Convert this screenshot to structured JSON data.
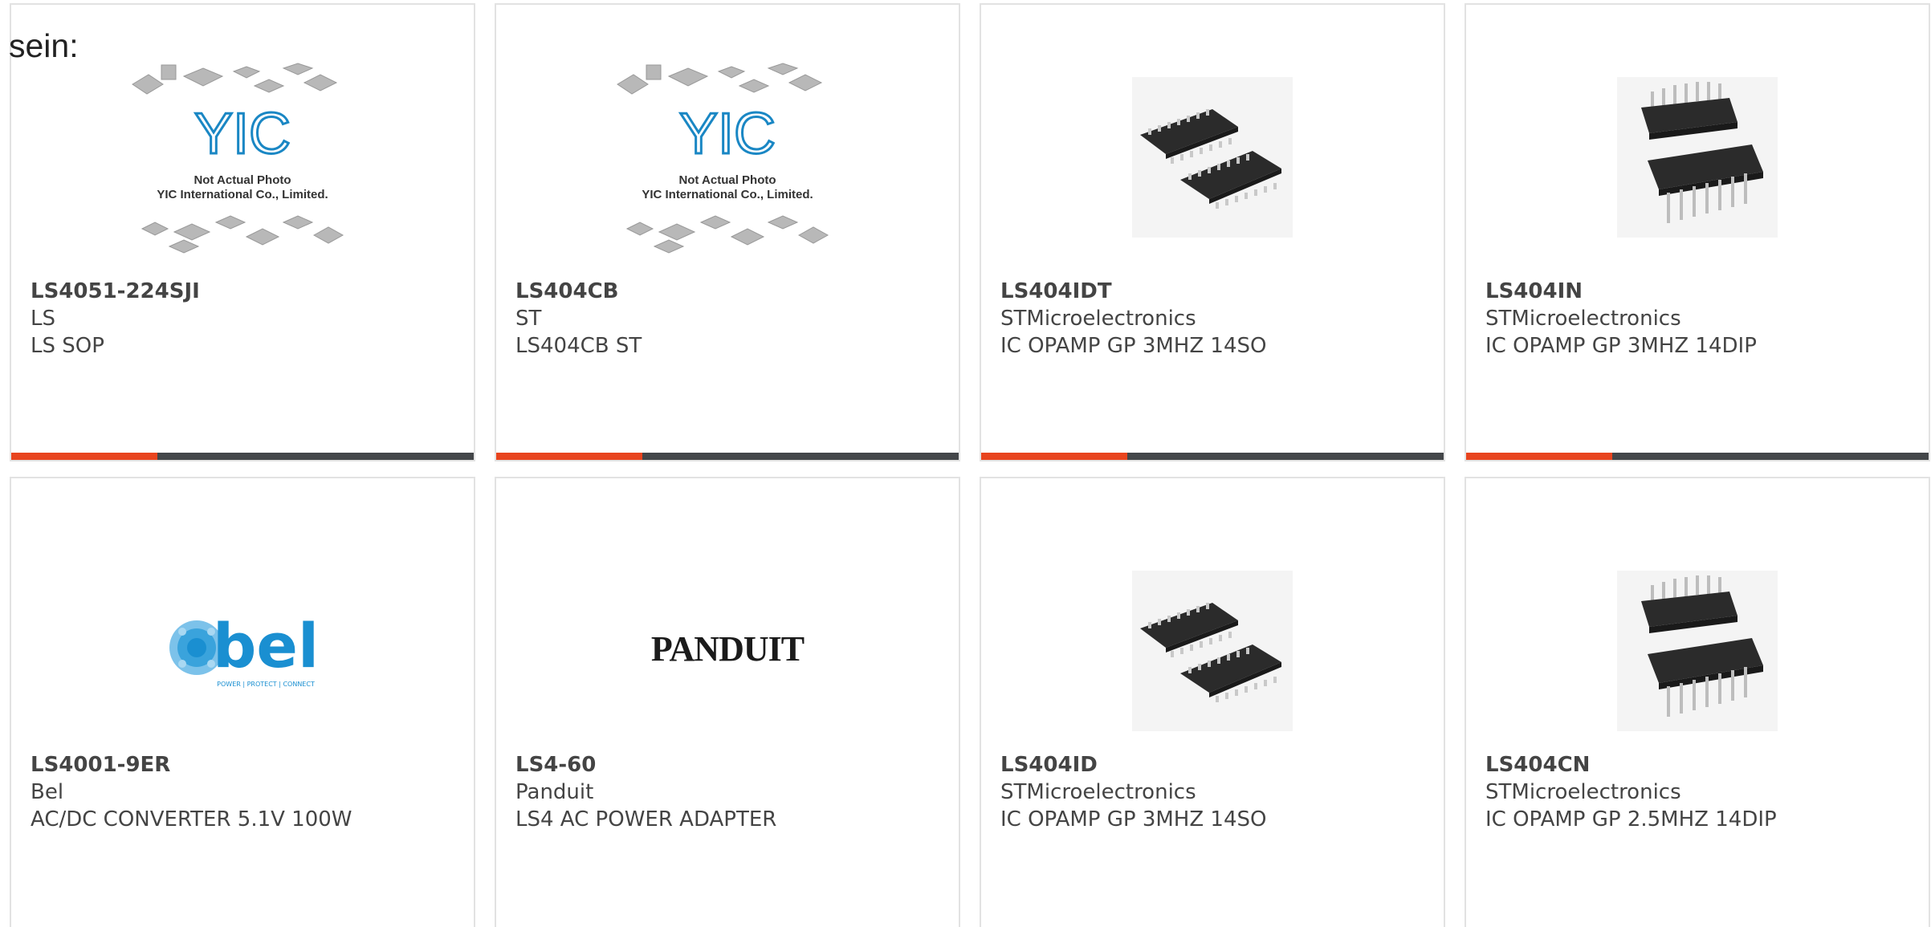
{
  "prefix_text": "sein:",
  "placeholder_image": {
    "line1": "Not Actual Photo",
    "line2": "YIC International Co., Limited.",
    "logo_text": "YIC"
  },
  "products": [
    {
      "part": "LS4051-224SJI",
      "maker": "LS",
      "desc": "LS SOP",
      "image": "placeholder"
    },
    {
      "part": "LS404CB",
      "maker": "ST",
      "desc": "LS404CB ST",
      "image": "placeholder"
    },
    {
      "part": "LS404IDT",
      "maker": "STMicroelectronics",
      "desc": "IC OPAMP GP 3MHZ 14SO",
      "image": "soic-chips"
    },
    {
      "part": "LS404IN",
      "maker": "STMicroelectronics",
      "desc": "IC OPAMP GP 3MHZ 14DIP",
      "image": "dip-chips"
    },
    {
      "part": "LS4001-9ER",
      "maker": "Bel",
      "desc": "AC/DC CONVERTER 5.1V 100W",
      "image": "bel-logo"
    },
    {
      "part": "LS4-60",
      "maker": "Panduit",
      "desc": "LS4 AC POWER ADAPTER",
      "image": "panduit-logo"
    },
    {
      "part": "LS404ID",
      "maker": "STMicroelectronics",
      "desc": "IC OPAMP GP 3MHZ 14SO",
      "image": "soic-chips"
    },
    {
      "part": "LS404CN",
      "maker": "STMicroelectronics",
      "desc": "IC OPAMP GP 2.5MHZ 14DIP",
      "image": "dip-chips"
    }
  ],
  "logos": {
    "bel": "bel",
    "bel_tagline": "POWER | PROTECT | CONNECT",
    "panduit": "PANDUIT"
  },
  "colors": {
    "accent": "#e8441e",
    "bar_dark": "#434649",
    "card_border": "#e2e2e2",
    "text": "#444444",
    "yic_blue": "#1a87c4",
    "bel_blue": "#1a8fd1"
  }
}
